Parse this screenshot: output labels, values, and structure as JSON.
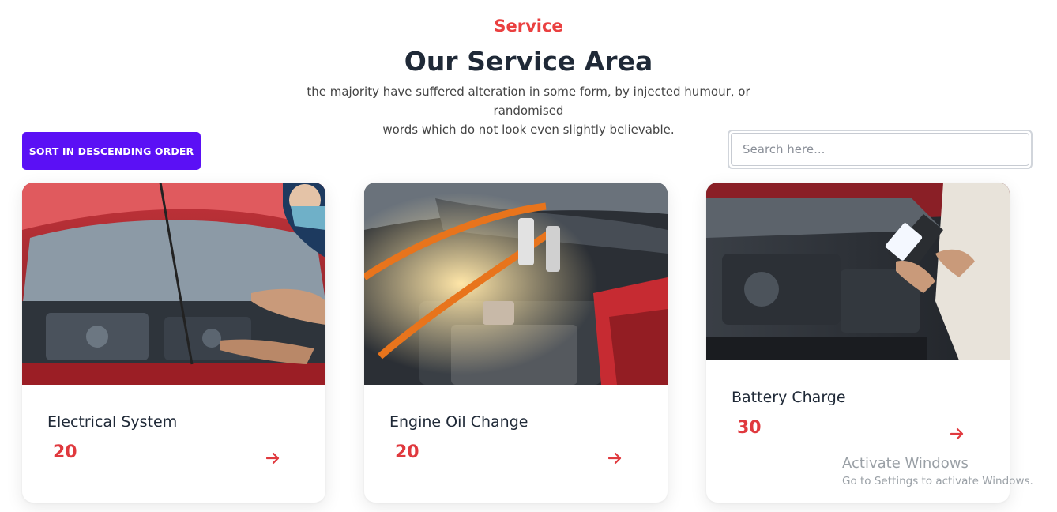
{
  "header": {
    "eyebrow": "Service",
    "title": "Our Service Area",
    "subtitle_line1": "the majority have suffered alteration in some form, by injected humour, or randomised",
    "subtitle_line2": "words which do not look even slightly believable."
  },
  "toolbar": {
    "sort_label": "SORT IN DESCENDING ORDER",
    "search_placeholder": "Search here...",
    "search_value": ""
  },
  "cards": [
    {
      "title": "Electrical System",
      "price": "20",
      "image": "mechanic-inspecting-engine-photo",
      "arrow_icon": "arrow-right-icon"
    },
    {
      "title": "Engine Oil Change",
      "price": "20",
      "image": "jumper-cables-on-battery-photo",
      "arrow_icon": "arrow-right-icon"
    },
    {
      "title": "Battery Charge",
      "price": "30",
      "image": "battery-tester-photo",
      "arrow_icon": "arrow-right-icon"
    }
  ],
  "watermark": {
    "title": "Activate Windows",
    "subtitle": "Go to Settings to activate Windows."
  },
  "colors": {
    "accent_red": "#ea4040",
    "button_purple": "#5b10f5",
    "heading": "#1f2937"
  }
}
